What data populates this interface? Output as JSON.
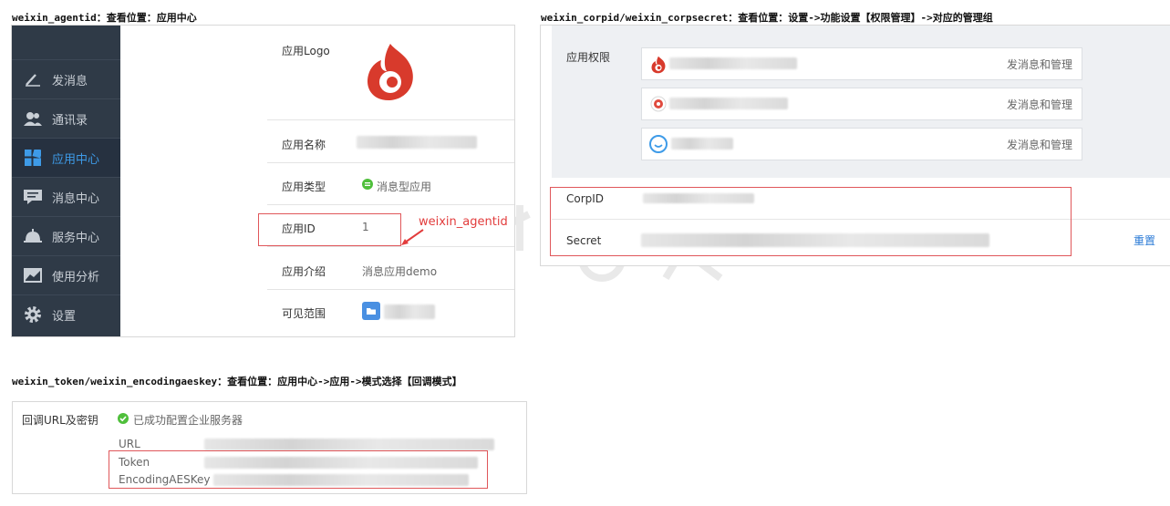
{
  "captions": {
    "panel1": "weixin_agentid：查看位置：应用中心",
    "panel2": "weixin_corpid/weixin_corpsecret：查看位置：设置->功能设置【权限管理】->对应的管理组",
    "panel3": "weixin_token/weixin_encodingaeskey：查看位置：应用中心->应用->模式选择【回调模式】"
  },
  "sidebar": {
    "items": [
      {
        "label": "发消息",
        "icon": "pencil-icon"
      },
      {
        "label": "通讯录",
        "icon": "contacts-icon"
      },
      {
        "label": "应用中心",
        "icon": "apps-grid-icon",
        "active": true
      },
      {
        "label": "消息中心",
        "icon": "message-icon"
      },
      {
        "label": "服务中心",
        "icon": "service-bell-icon"
      },
      {
        "label": "使用分析",
        "icon": "chart-icon"
      },
      {
        "label": "设置",
        "icon": "gear-icon"
      }
    ]
  },
  "app_detail": {
    "logo_label": "应用Logo",
    "name_label": "应用名称",
    "type_label": "应用类型",
    "type_value": "消息型应用",
    "id_label": "应用ID",
    "id_value": "1",
    "intro_label": "应用介绍",
    "intro_value": "消息应用demo",
    "scope_label": "可见范围"
  },
  "annotation": {
    "agentid_note": "weixin_agentid"
  },
  "permissions": {
    "label": "应用权限",
    "apps": [
      {
        "manage": "发消息和管理",
        "icon": "flame-logo-icon"
      },
      {
        "manage": "发消息和管理",
        "icon": "red-badge-icon"
      },
      {
        "manage": "发消息和管理",
        "icon": "smile-bubble-icon"
      }
    ],
    "corpid_label": "CorpID",
    "secret_label": "Secret",
    "reset": "重置"
  },
  "callback": {
    "title": "回调URL及密钥",
    "status": "已成功配置企业服务器",
    "url_label": "URL",
    "token_label": "Token",
    "aes_label": "EncodingAESKey"
  },
  "colors": {
    "accent": "#3e9be8",
    "highlight": "#e0575a",
    "sidebar": "#2f3a47",
    "success": "#4fbf3b",
    "link": "#2a7ad6"
  }
}
